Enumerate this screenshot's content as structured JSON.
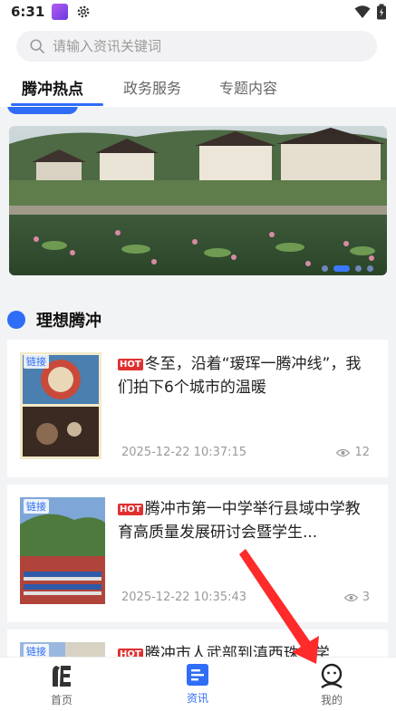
{
  "status_bar": {
    "time": "6:31",
    "icons": [
      "app-notification-icon",
      "gear-icon",
      "wifi-icon",
      "battery-icon"
    ]
  },
  "search": {
    "placeholder": "请输入资讯关键词",
    "value": ""
  },
  "tabs": [
    {
      "label": "腾冲热点",
      "active": true
    },
    {
      "label": "政务服务",
      "active": false
    },
    {
      "label": "专题内容",
      "active": false
    }
  ],
  "carousel": {
    "slide_count": 4,
    "active_index": 1
  },
  "section": {
    "title": "理想腾冲"
  },
  "articles": [
    {
      "thumb_label": "链接",
      "badge": "HOT",
      "title": "冬至，沿着“瑷珲一腾冲线”，我们拍下6个城市的温暖",
      "date": "2025-12-22 10:37:15",
      "views": "12"
    },
    {
      "thumb_label": "链接",
      "badge": "HOT",
      "title": "腾冲市第一中学举行县域中学教育高质量发展研讨会暨学生...",
      "date": "2025-12-22 10:35:43",
      "views": "3"
    },
    {
      "thumb_label": "链接",
      "badge": "HOT",
      "title": "腾冲市人武部到滇西珠宝学",
      "date": "",
      "views": ""
    }
  ],
  "bottom_nav": [
    {
      "label": "首页",
      "icon": "home-logo-icon",
      "active": false
    },
    {
      "label": "资讯",
      "icon": "news-icon",
      "active": true
    },
    {
      "label": "我的",
      "icon": "profile-icon",
      "active": false
    }
  ],
  "colors": {
    "accent": "#2f6df6",
    "hot_badge": "#e03030",
    "arrow": "#ff2a2a"
  }
}
